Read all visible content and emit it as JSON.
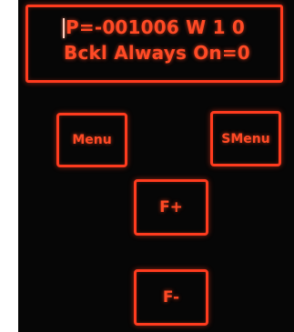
{
  "display": {
    "line1": "P=-001006 W 1 0",
    "line2": "Bckl Always On=0"
  },
  "buttons": {
    "menu": "Menu",
    "smenu": "SMenu",
    "f_plus": "F+",
    "f_minus": "F-"
  },
  "colors": {
    "accent": "#ff3b1e",
    "background": "#060606"
  }
}
